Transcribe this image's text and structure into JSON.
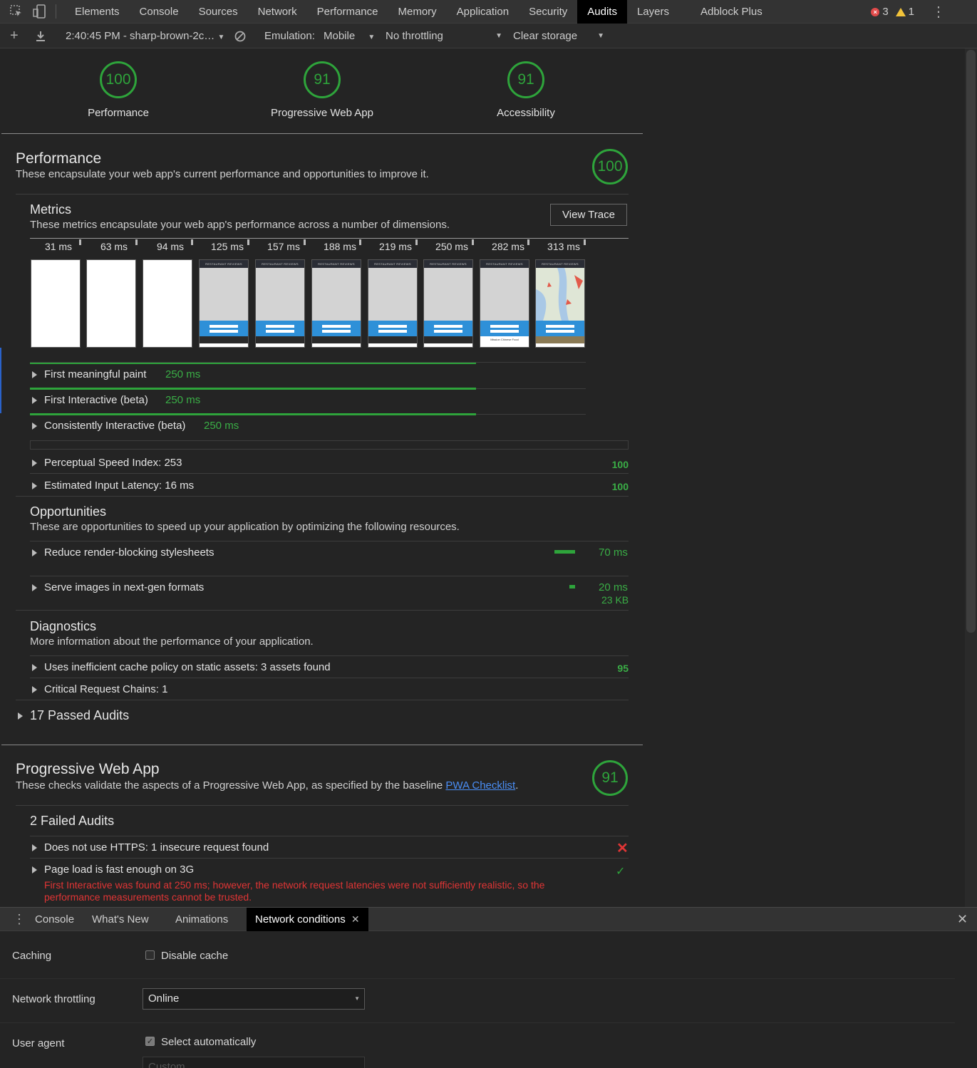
{
  "tabbar": {
    "tabs": [
      "Elements",
      "Console",
      "Sources",
      "Network",
      "Performance",
      "Memory",
      "Application",
      "Security",
      "Audits",
      "Layers",
      "Adblock Plus"
    ],
    "active": "Audits",
    "errors": "3",
    "warnings": "1"
  },
  "toolbar": {
    "report_select": "2:40:45 PM - sharp-brown-2c…",
    "emulation_label": "Emulation:",
    "emulation_value": "Mobile",
    "throttling_value": "No throttling",
    "storage_value": "Clear storage"
  },
  "summary": [
    {
      "score": "100",
      "label": "Performance"
    },
    {
      "score": "91",
      "label": "Progressive Web App"
    },
    {
      "score": "91",
      "label": "Accessibility"
    }
  ],
  "performance": {
    "title": "Performance",
    "desc": "These encapsulate your web app's current performance and opportunities to improve it.",
    "score": "100",
    "metrics_title": "Metrics",
    "metrics_desc": "These metrics encapsulate your web app's performance across a number of dimensions.",
    "view_trace": "View Trace",
    "filmstrip_times": [
      "31 ms",
      "63 ms",
      "94 ms",
      "125 ms",
      "157 ms",
      "188 ms",
      "219 ms",
      "250 ms",
      "282 ms",
      "313 ms"
    ],
    "frame_header": "RESTAURANT REVIEWS",
    "frame_caption": "Mission Chinese Food",
    "timing_metrics": [
      {
        "label": "First meaningful paint",
        "value": "250 ms"
      },
      {
        "label": "First Interactive (beta)",
        "value": "250 ms"
      },
      {
        "label": "Consistently Interactive (beta)",
        "value": "250 ms"
      }
    ],
    "scored_metrics": [
      {
        "label": "Perceptual Speed Index: 253",
        "score": "100"
      },
      {
        "label": "Estimated Input Latency: 16 ms",
        "score": "100"
      }
    ],
    "opportunities_title": "Opportunities",
    "opportunities_desc": "These are opportunities to speed up your application by optimizing the following resources.",
    "opportunities": [
      {
        "label": "Reduce render-blocking stylesheets",
        "value": "70 ms",
        "extra": ""
      },
      {
        "label": "Serve images in next-gen formats",
        "value": "20 ms",
        "extra": "23 KB"
      }
    ],
    "diagnostics_title": "Diagnostics",
    "diagnostics_desc": "More information about the performance of your application.",
    "diagnostics": [
      {
        "label": "Uses inefficient cache policy on static assets: 3 assets found",
        "score": "95"
      },
      {
        "label": "Critical Request Chains: 1",
        "score": ""
      }
    ],
    "passed": "17 Passed Audits"
  },
  "pwa": {
    "title": "Progressive Web App",
    "desc_before": "These checks validate the aspects of a Progressive Web App, as specified by the baseline ",
    "desc_link": "PWA Checklist",
    "desc_after": ".",
    "score": "91",
    "failed_title": "2 Failed Audits",
    "audits": [
      {
        "label": "Does not use HTTPS: 1 insecure request found"
      },
      {
        "label": "Page load is fast enough on 3G"
      }
    ],
    "error_line1": "First Interactive was found at 250 ms; however, the network request latencies were not sufficiently realistic, so the",
    "error_line2": "performance measurements cannot be trusted."
  },
  "drawer": {
    "tabs": [
      "Console",
      "What's New",
      "Animations",
      "Network conditions"
    ],
    "active": "Network conditions",
    "caching_label": "Caching",
    "disable_cache": "Disable cache",
    "throttling_label": "Network throttling",
    "throttling_value": "Online",
    "ua_label": "User agent",
    "select_auto": "Select automatically",
    "custom_placeholder": "Custom..."
  },
  "colors": {
    "pass": "#2ea43b",
    "fail": "#e03535",
    "link": "#4a8ef5"
  }
}
